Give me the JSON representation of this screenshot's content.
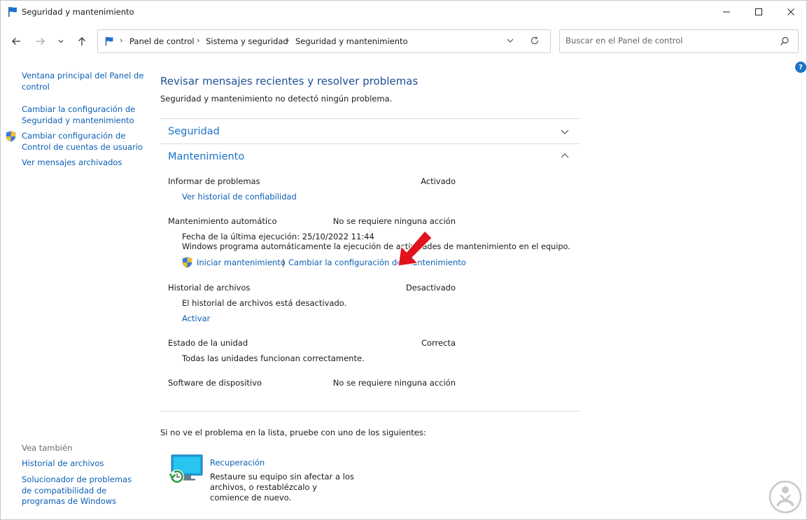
{
  "window": {
    "title": "Seguridad y mantenimiento",
    "controls": {
      "minimize": "—",
      "maximize": "☐",
      "close": "✕"
    }
  },
  "nav": {
    "breadcrumb": [
      "Panel de control",
      "Sistema y seguridad",
      "Seguridad y mantenimiento"
    ],
    "search_placeholder": "Buscar en el Panel de control"
  },
  "sidebar": {
    "links": [
      {
        "label": "Ventana principal del Panel de control"
      },
      {
        "label": "Cambiar la configuración de Seguridad y mantenimiento"
      },
      {
        "label": "Cambiar configuración de Control de cuentas de usuario"
      },
      {
        "label": "Ver mensajes archivados"
      }
    ],
    "see_also_title": "Vea también",
    "see_also": [
      {
        "label": "Historial de archivos"
      },
      {
        "label": "Solucionador de problemas de compatibilidad de programas de Windows"
      }
    ]
  },
  "main": {
    "title": "Revisar mensajes recientes y resolver problemas",
    "subtitle": "Seguridad y mantenimiento no detectó ningún problema.",
    "sections": {
      "security": {
        "title": "Seguridad"
      },
      "maintenance": {
        "title": "Mantenimiento"
      }
    },
    "items": {
      "problem_reports": {
        "label": "Informar de problemas",
        "status": "Activado",
        "link": "Ver historial de confiabilidad"
      },
      "auto_maintenance": {
        "label": "Mantenimiento automático",
        "status": "No se requiere ninguna acción",
        "last_run": "Fecha de la última ejecución: 25/10/2022 11:44",
        "description": "Windows programa automáticamente la ejecución de actividades de mantenimiento en el equipo.",
        "start_link": "Iniciar mantenimiento",
        "separator": "|",
        "settings_link": "Cambiar la configuración de mantenimiento"
      },
      "file_history": {
        "label": "Historial de archivos",
        "status": "Desactivado",
        "description": "El historial de archivos está desactivado.",
        "link": "Activar"
      },
      "drive_status": {
        "label": "Estado de la unidad",
        "status": "Correcta",
        "description": "Todas las unidades funcionan correctamente."
      },
      "device_software": {
        "label": "Software de dispositivo",
        "status": "No se requiere ninguna acción"
      }
    },
    "footer_prompt": "Si no ve el problema en la lista, pruebe con uno de los siguientes:",
    "recovery": {
      "title": "Recuperación",
      "description_lines": [
        "Restaure su equipo sin afectar a los",
        "archivos, o restablézcalo y",
        "comience de nuevo."
      ]
    }
  },
  "colors": {
    "link": "#0a5fb4",
    "heading": "#1a73c8",
    "annotation_arrow": "#e0121b"
  }
}
